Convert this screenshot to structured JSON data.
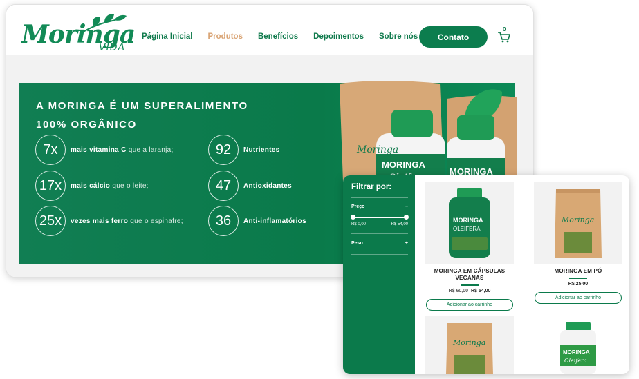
{
  "brand": {
    "logo_script": "Moringa",
    "logo_sub": "VIDA"
  },
  "nav": {
    "items": [
      {
        "label": "Página Inicial",
        "active": false
      },
      {
        "label": "Produtos",
        "active": true
      },
      {
        "label": "Benefícios",
        "active": false
      },
      {
        "label": "Depoimentos",
        "active": false
      },
      {
        "label": "Sobre nós",
        "active": false
      }
    ],
    "contact_label": "Contato",
    "cart_count": "0"
  },
  "hero": {
    "title_line1": "A MORINGA É UM SUPERALIMENTO",
    "title_line2": "100% ORGÂNICO",
    "stats_left": [
      {
        "value": "7x",
        "bold": "mais vitamina C",
        "light": "que a laranja;"
      },
      {
        "value": "17x",
        "bold": "mais cálcio",
        "light": "que o leite;"
      },
      {
        "value": "25x",
        "bold": "vezes mais ferro",
        "light": "que o espinafre;"
      }
    ],
    "stats_right": [
      {
        "value": "92",
        "label": "Nutrientes"
      },
      {
        "value": "47",
        "label": "Antioxidantes"
      },
      {
        "value": "36",
        "label": "Anti-inflamatórios"
      }
    ],
    "bottle_label_1a": "MORINGA",
    "bottle_label_1b": "Oleifera",
    "bottle_label_2a": "MORINGA",
    "pouch_label": "Moringa"
  },
  "shop": {
    "filter_title": "Filtrar por:",
    "price_label": "Preço",
    "price_toggle": "–",
    "price_min": "R$ 0,00",
    "price_max": "R$ 54,00",
    "weight_label": "Peso",
    "weight_toggle": "+",
    "products": [
      {
        "name": "MORINGA EM CÁPSULAS VEGANAS",
        "old_price": "R$ 60,00",
        "price": "R$ 54,00",
        "button": "Adicionar ao carrinho",
        "bottle_a": "MORINGA",
        "bottle_b": "OLEIFERA"
      },
      {
        "name": "MORINGA EM PÓ",
        "old_price": "",
        "price": "R$ 25,00",
        "button": "Adicionar ao carrinho",
        "pouch": "Moringa"
      },
      {
        "pouch": "Moringa"
      },
      {
        "bottle_a": "MORINGA",
        "bottle_b": "Oleifera"
      }
    ]
  },
  "colors": {
    "brand_green": "#0c7d4e",
    "accent_tan": "#d9a373",
    "hero_green": "#117e53"
  }
}
